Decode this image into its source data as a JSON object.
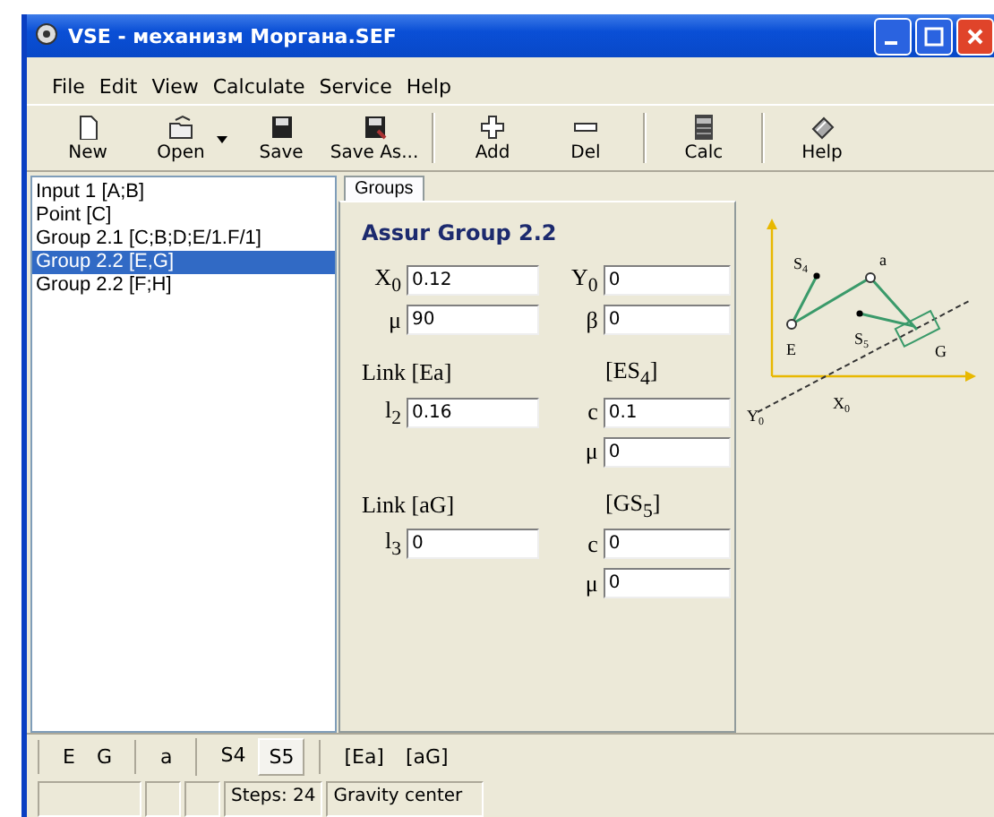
{
  "window": {
    "title": "VSE - механизм Моргана.SEF"
  },
  "menu": [
    "File",
    "Edit",
    "View",
    "Calculate",
    "Service",
    "Help"
  ],
  "toolbar": [
    {
      "label": "New",
      "kind": "new"
    },
    {
      "label": "Open",
      "kind": "open"
    },
    {
      "label": "Save",
      "kind": "save"
    },
    {
      "label": "Save As...",
      "kind": "saveas"
    },
    {
      "label": "Add",
      "kind": "add"
    },
    {
      "label": "Del",
      "kind": "del"
    },
    {
      "label": "Calc",
      "kind": "calc"
    },
    {
      "label": "Help",
      "kind": "help"
    }
  ],
  "tree": [
    {
      "label": "Input 1 [A;B]",
      "selected": false
    },
    {
      "label": "Point [C]",
      "selected": false
    },
    {
      "label": "Group 2.1 [C;B;D;E/1.F/1]",
      "selected": false
    },
    {
      "label": "Group 2.2 [E,G]",
      "selected": true
    },
    {
      "label": "Group 2.2 [F;H]",
      "selected": false
    }
  ],
  "tabs": [
    {
      "label": "Groups",
      "selected": true
    }
  ],
  "form": {
    "title": "Assur Group 2.2",
    "rows": [
      {
        "left": {
          "kind": "field",
          "label": "X$_{0}$",
          "value": "0.12"
        },
        "right": {
          "kind": "field",
          "label": "Y$_{0}$",
          "value": "0"
        }
      },
      {
        "left": {
          "kind": "field",
          "label": "μ",
          "value": "90"
        },
        "right": {
          "kind": "field",
          "label": "β",
          "value": "0"
        }
      },
      {
        "left": {
          "kind": "heading",
          "text": "Link [Ea]"
        },
        "right": {
          "kind": "heading",
          "text": "[ES$_{4}$]"
        }
      },
      {
        "left": {
          "kind": "field",
          "label": "l$_{2}$",
          "value": "0.16"
        },
        "right": {
          "kind": "field",
          "label": "c",
          "value": "0.1"
        }
      },
      {
        "right": {
          "kind": "field",
          "label": "μ",
          "value": "0"
        }
      },
      {
        "left": {
          "kind": "heading",
          "text": "Link [aG]"
        },
        "right": {
          "kind": "heading",
          "text": "[GS$_{5}$]"
        }
      },
      {
        "left": {
          "kind": "field",
          "label": "l$_{3}$",
          "value": "0"
        },
        "right": {
          "kind": "field",
          "label": "c",
          "value": "0"
        }
      },
      {
        "right": {
          "kind": "field",
          "label": "μ",
          "value": "0"
        }
      }
    ]
  },
  "diagram": {
    "labels": [
      "S$_{4}$",
      "a",
      "E",
      "S$_{5}$",
      "G",
      "X$_{0}$",
      "Y$_{0}$"
    ]
  },
  "bottom_bar": [
    {
      "items": [
        {
          "label": "E",
          "selected": false
        },
        {
          "label": "G",
          "selected": false
        }
      ]
    },
    {
      "items": [
        {
          "label": "a",
          "selected": false
        }
      ]
    },
    {
      "items": [
        {
          "label": "S4",
          "selected": false
        },
        {
          "label": "S5",
          "selected": true
        }
      ]
    },
    {
      "items": [
        {
          "label": "[Ea]",
          "selected": false
        },
        {
          "label": "[aG]",
          "selected": false
        }
      ]
    }
  ],
  "status_bar": [
    "Steps: 24",
    "Gravity center"
  ]
}
